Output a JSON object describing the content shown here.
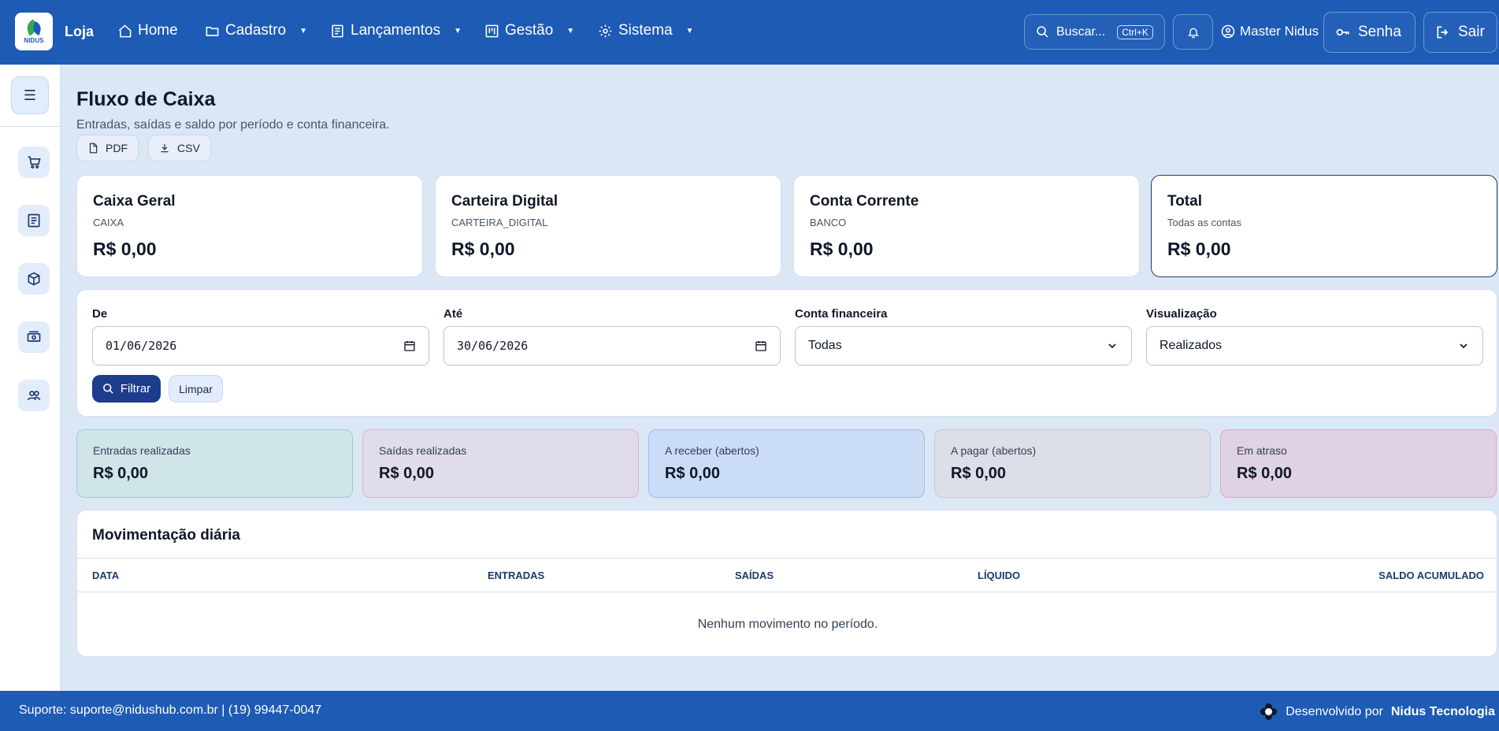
{
  "header": {
    "logo_text": "NIDUS",
    "brand": "Loja",
    "nav": [
      {
        "label": "Home",
        "icon": "home-icon"
      },
      {
        "label": "Cadastro",
        "icon": "folder-icon"
      },
      {
        "label": "Lançamentos",
        "icon": "receipt-icon"
      },
      {
        "label": "Gestão",
        "icon": "board-icon"
      },
      {
        "label": "Sistema",
        "icon": "gear-icon"
      }
    ],
    "search_label": "Buscar...",
    "search_shortcut": "Ctrl+K",
    "user": "Master Nidus",
    "password_label": "Senha",
    "logout_label": "Sair"
  },
  "sidebar": {
    "menu_glyph": "☰",
    "items": [
      "cart-icon",
      "receipt-icon",
      "box-icon",
      "cash-icon",
      "users-icon"
    ]
  },
  "page": {
    "title": "Fluxo de Caixa",
    "subtitle": "Entradas, saídas e saldo por período e conta financeira.",
    "export_pdf": "PDF",
    "export_csv": "CSV"
  },
  "accounts": [
    {
      "name": "Caixa Geral",
      "kind": "CAIXA",
      "amount": "R$ 0,00"
    },
    {
      "name": "Carteira Digital",
      "kind": "CARTEIRA_DIGITAL",
      "amount": "R$ 0,00"
    },
    {
      "name": "Conta Corrente",
      "kind": "BANCO",
      "amount": "R$ 0,00"
    },
    {
      "name": "Total",
      "kind": "Todas as contas",
      "amount": "R$ 0,00"
    }
  ],
  "filters": {
    "from_label": "De",
    "from_value": "01/06/2026",
    "to_label": "Até",
    "to_value": "30/06/2026",
    "account_label": "Conta financeira",
    "account_value": "Todas",
    "view_label": "Visualização",
    "view_value": "Realizados",
    "filter_button": "Filtrar",
    "clear_button": "Limpar"
  },
  "stats": [
    {
      "label": "Entradas realizadas",
      "value": "R$ 0,00",
      "bg": "#cfe5e8",
      "border": "#9ccfc4"
    },
    {
      "label": "Saídas realizadas",
      "value": "R$ 0,00",
      "bg": "#e0dcea",
      "border": "#e3b4c2"
    },
    {
      "label": "A receber (abertos)",
      "value": "R$ 0,00",
      "bg": "#cadcf6",
      "border": "#9ebceb"
    },
    {
      "label": "A pagar (abertos)",
      "value": "R$ 0,00",
      "bg": "#dcdfe7",
      "border": "#cfc6c4"
    },
    {
      "label": "Em atraso",
      "value": "R$ 0,00",
      "bg": "#dfd2e2",
      "border": "#e3a9bd"
    }
  ],
  "table": {
    "title": "Movimentação diária",
    "columns": [
      "DATA",
      "ENTRADAS",
      "SAÍDAS",
      "LÍQUIDO",
      "SALDO ACUMULADO"
    ],
    "empty_text": "Nenhum movimento no período."
  },
  "footer": {
    "support": "Suporte: suporte@nidushub.com.br | (19) 99447-0047",
    "developed_by": "Desenvolvido por",
    "company": "Nidus Tecnologia"
  }
}
